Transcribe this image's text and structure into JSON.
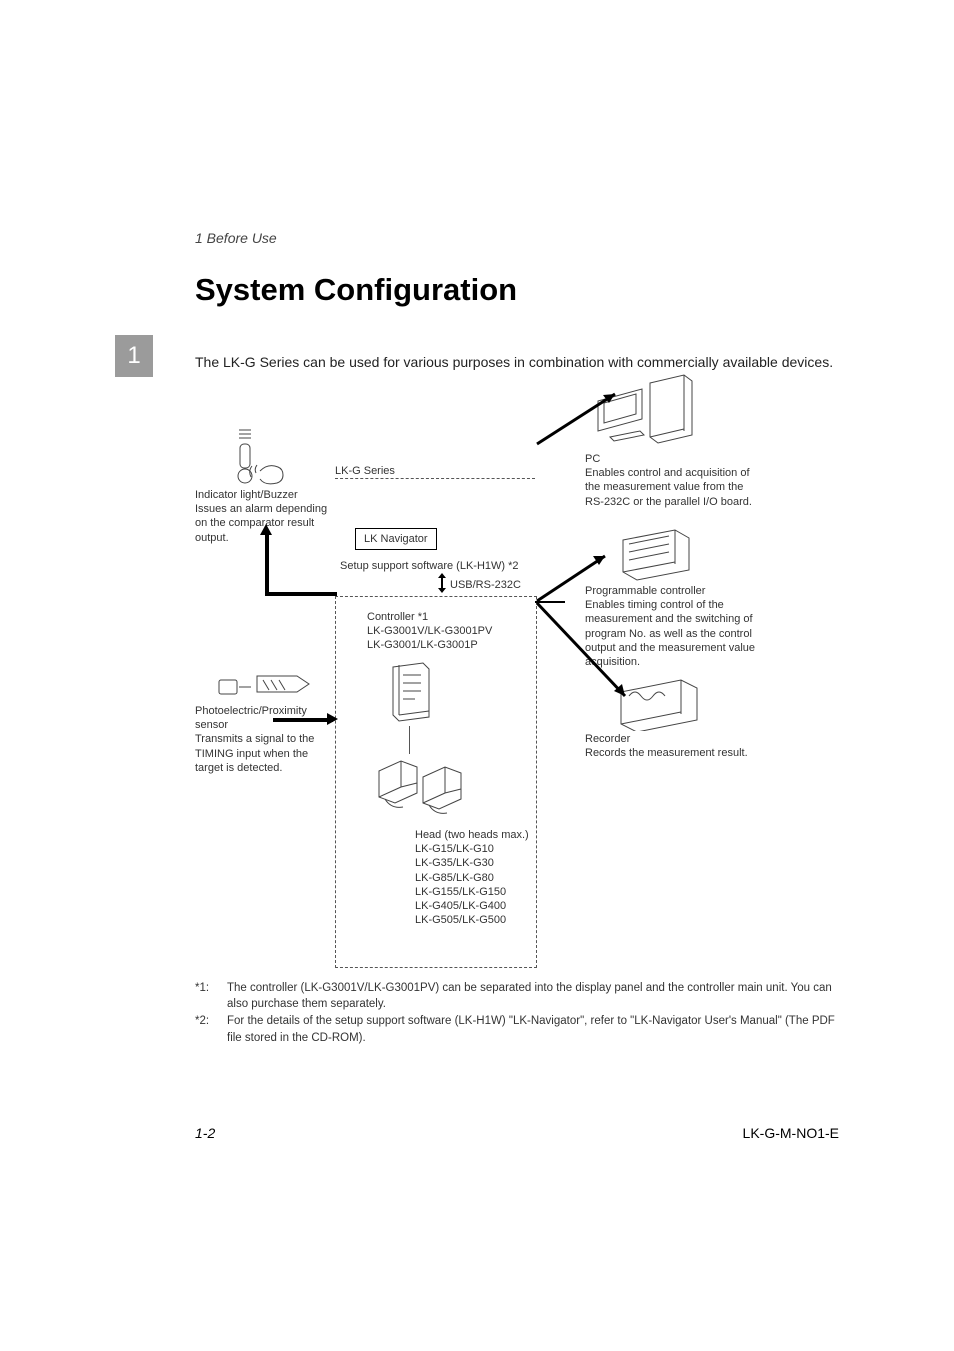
{
  "breadcrumb": "1  Before Use",
  "title": "System Configuration",
  "tab": "1",
  "intro": "The LK-G Series can be used for various purposes in combination with commercially available devices.",
  "diagram": {
    "series_label": "LK-G Series",
    "navigator_box": "LK Navigator",
    "setup_sw": "Setup support software (LK-H1W) *2",
    "usb": "USB/RS-232C",
    "controller_title": "Controller *1",
    "controller_models1": "LK-G3001V/LK-G3001PV",
    "controller_models2": "LK-G3001/LK-G3001P",
    "head_title": "Head (two heads max.)",
    "head_models": [
      "LK-G15/LK-G10",
      "LK-G35/LK-G30",
      "LK-G85/LK-G80",
      "LK-G155/LK-G150",
      "LK-G405/LK-G400",
      "LK-G505/LK-G500"
    ],
    "indicator_title": "Indicator light/Buzzer",
    "indicator_desc": "Issues an alarm depending on the comparator result output.",
    "sensor_title": "Photoelectric/Proximity sensor",
    "sensor_desc": "Transmits a signal to the TIMING input when the target is detected.",
    "pc_title": "PC",
    "pc_desc": "Enables control and acquisition of the measurement value from the RS-232C or the parallel I/O board.",
    "plc_title": "Programmable controller",
    "plc_desc": "Enables timing control of the measurement and the switching of program No. as well as the control output and the measurement value acquisition.",
    "recorder_title": "Recorder",
    "recorder_desc": "Records the measurement result."
  },
  "notes": [
    {
      "k": "*1:",
      "v": "The controller (LK-G3001V/LK-G3001PV) can be separated into the display panel and the controller main unit. You can also purchase them separately."
    },
    {
      "k": "*2:",
      "v": "For the details of the setup support software (LK-H1W) \"LK-Navigator\", refer to \"LK-Navigator User's Manual\" (The PDF file stored in the CD-ROM)."
    }
  ],
  "footer": {
    "page": "1-2",
    "doc": "LK-G-M-NO1-E"
  }
}
